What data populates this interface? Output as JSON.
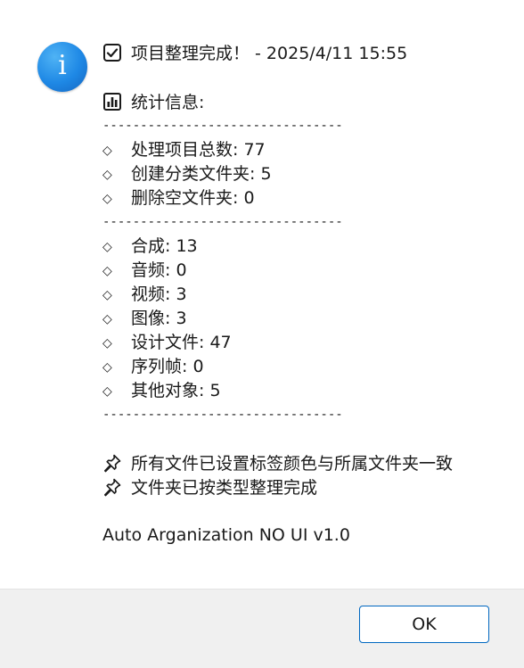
{
  "dialog": {
    "icon": "info-icon",
    "icon_glyph": "i",
    "header": {
      "icon": "checkbox-checked-icon",
      "text": "项目整理完成！ - 2025/4/11 15:55"
    },
    "stats_heading": {
      "icon": "bar-chart-icon",
      "text": "统计信息:"
    },
    "separator": "--------------------------------",
    "bullet_glyph": "◇",
    "summary_items": [
      "处理项目总数: 77",
      "创建分类文件夹: 5",
      "删除空文件夹: 0"
    ],
    "category_items": [
      "合成: 13",
      "音频: 0",
      "视频: 3",
      "图像: 3",
      "设计文件: 47",
      "序列帧: 0",
      "其他对象: 5"
    ],
    "notes": [
      {
        "icon": "pushpin-icon",
        "text": "所有文件已设置标签颜色与所属文件夹一致"
      },
      {
        "icon": "pushpin-icon",
        "text": "文件夹已按类型整理完成"
      }
    ],
    "version": "Auto Arganization NO UI v1.0",
    "ok_label": "OK"
  },
  "colors": {
    "accent": "#0067c0",
    "info_icon": "#1e88e5",
    "footer_bg": "#f0f0f0"
  }
}
